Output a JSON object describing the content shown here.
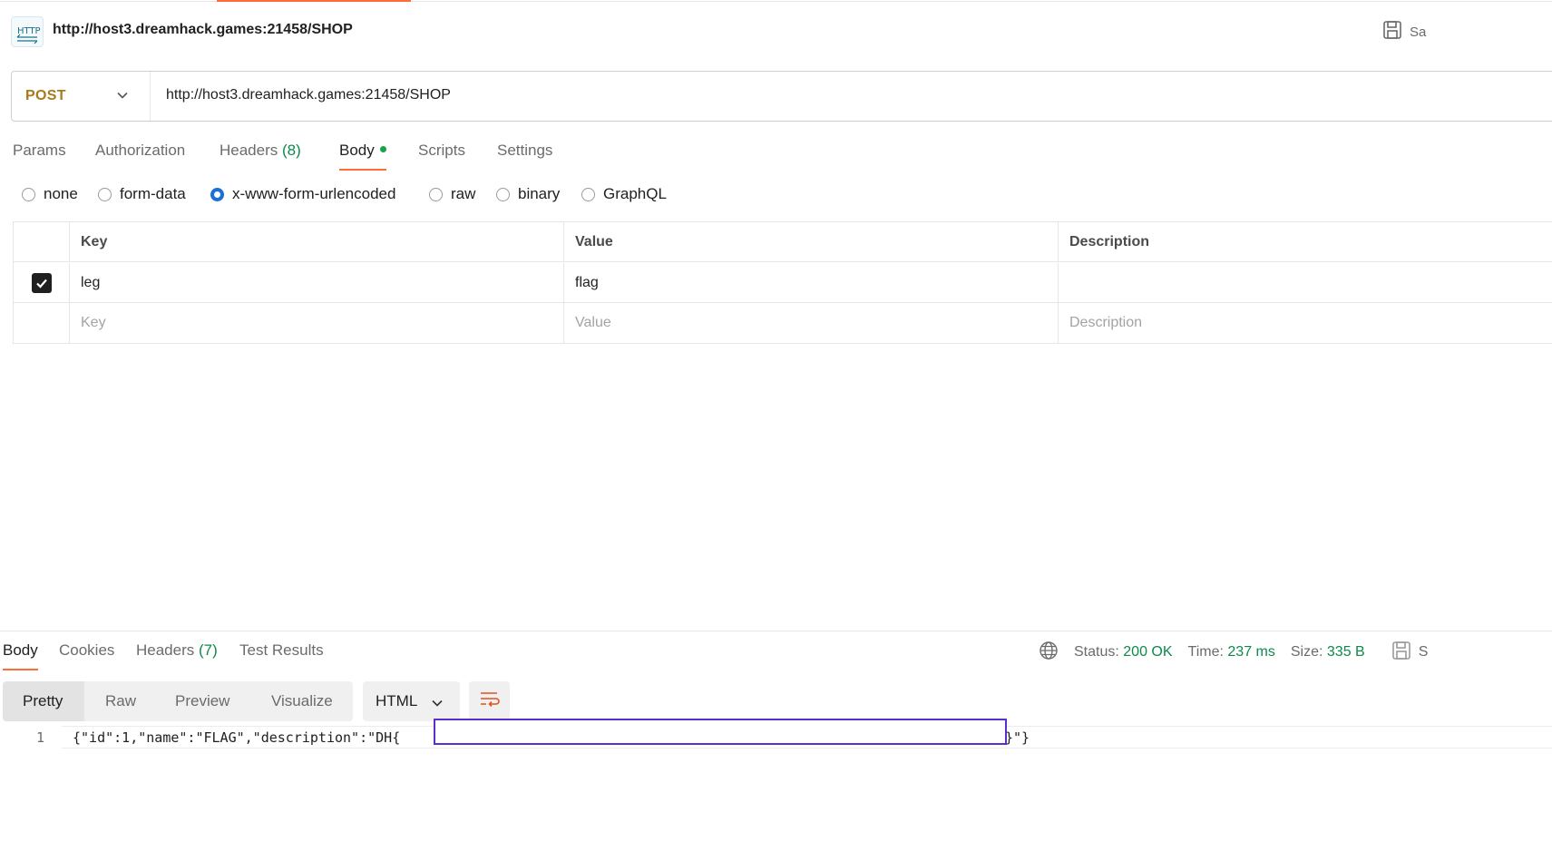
{
  "request": {
    "title": "http://host3.dreamhack.games:21458/SHOP",
    "save_label": "Sa",
    "method": "POST",
    "url": "http://host3.dreamhack.games:21458/SHOP",
    "http_icon_label": "HTTP"
  },
  "request_tabs": [
    {
      "label": "Params"
    },
    {
      "label": "Authorization"
    },
    {
      "label": "Headers",
      "count": "(8)"
    },
    {
      "label": "Body",
      "active": true
    },
    {
      "label": "Scripts"
    },
    {
      "label": "Settings"
    }
  ],
  "body_types": [
    {
      "label": "none",
      "checked": false
    },
    {
      "label": "form-data",
      "checked": false
    },
    {
      "label": "x-www-form-urlencoded",
      "checked": true
    },
    {
      "label": "raw",
      "checked": false
    },
    {
      "label": "binary",
      "checked": false
    },
    {
      "label": "GraphQL",
      "checked": false
    }
  ],
  "table": {
    "headers": {
      "key": "Key",
      "value": "Value",
      "description": "Description"
    },
    "rows": [
      {
        "checked": true,
        "key": "leg",
        "value": "flag",
        "description": ""
      }
    ],
    "placeholders": {
      "key": "Key",
      "value": "Value",
      "description": "Description"
    }
  },
  "response_tabs": [
    {
      "label": "Body",
      "active": true
    },
    {
      "label": "Cookies"
    },
    {
      "label": "Headers",
      "count": "(7)"
    },
    {
      "label": "Test Results"
    }
  ],
  "response_meta": {
    "status_label": "Status:",
    "status_value": "200 OK",
    "time_label": "Time:",
    "time_value": "237 ms",
    "size_label": "Size:",
    "size_value": "335 B",
    "save_label": "S"
  },
  "view_modes": [
    {
      "label": "Pretty",
      "active": true
    },
    {
      "label": "Raw"
    },
    {
      "label": "Preview"
    },
    {
      "label": "Visualize"
    }
  ],
  "format": "HTML",
  "code": {
    "line_number": "1",
    "text_prefix": "{\"id\":1,\"name\":\"FLAG\",\"description\":\"DH{",
    "text_suffix": "}\"}"
  },
  "colors": {
    "accent": "#ff6c37",
    "method": "#a87a1c",
    "success": "#0c8a4a",
    "radio_checked": "#1a6fd8",
    "redaction_border": "#5b2fc9"
  }
}
